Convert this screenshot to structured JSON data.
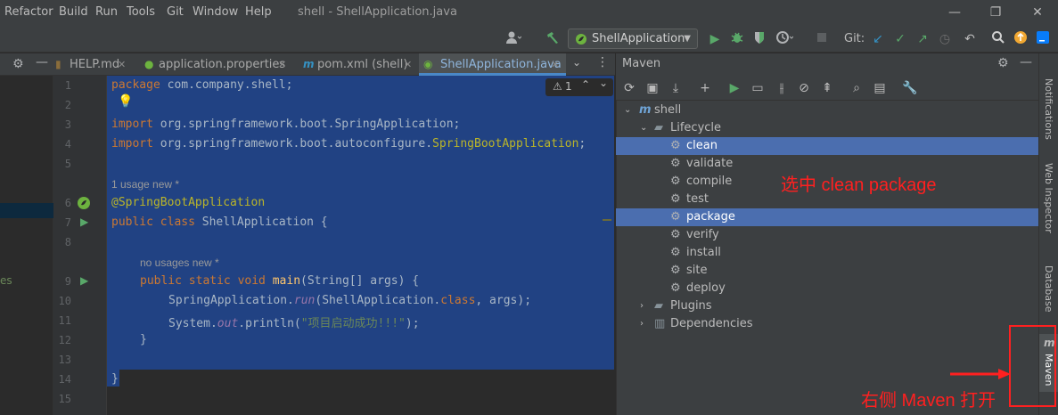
{
  "menubar": {
    "items": [
      "Refactor",
      "Build",
      "Run",
      "Tools",
      "Git",
      "Window",
      "Help"
    ],
    "window_title": "shell - ShellApplication.java",
    "controls": [
      "—",
      "❐",
      "✕"
    ]
  },
  "toolbar": {
    "run_config": "ShellApplication",
    "git_label": "Git:"
  },
  "tabs": [
    {
      "label": "HELP.md"
    },
    {
      "label": "application.properties"
    },
    {
      "label": "pom.xml (shell)"
    },
    {
      "label": "ShellApplication.java"
    }
  ],
  "editor": {
    "line_numbers": [
      "1",
      "2",
      "3",
      "4",
      "5",
      "6",
      "7",
      "8",
      "9",
      "10",
      "11",
      "12",
      "13",
      "14",
      "15"
    ],
    "inspection_count": "1",
    "lines": {
      "l1_kw": "package",
      "l1_rest": " com.company.shell;",
      "l3_kw": "import",
      "l3_rest": " org.springframework.boot.SpringApplication;",
      "l4_kw": "import",
      "l4_rest": " org.springframework.boot.autoconfigure.",
      "l4_ann": "SpringBootApplication",
      "l4_end": ";",
      "hint1": "1 usage   new *",
      "l6_ann": "@SpringBootApplication",
      "l7_kw": "public class",
      "l7_rest": " ShellApplication {",
      "hint2": "no usages   new *",
      "l9_kw": "public static void",
      "l9_fn": " main",
      "l9_rest": "(String[] args) {",
      "l10_a": "SpringApplication.",
      "l10_it": "run",
      "l10_b": "(ShellApplication.",
      "l10_kw": "class",
      "l10_c": ", args);",
      "l11_a": "System.",
      "l11_it": "out",
      "l11_b": ".println(",
      "l11_str": "\"项目启动成功!!!\"",
      "l11_c": ");",
      "l12": "}",
      "l14": "}"
    }
  },
  "maven": {
    "title": "Maven",
    "tree": {
      "project": "shell",
      "lifecycle": "Lifecycle",
      "goals": [
        "clean",
        "validate",
        "compile",
        "test",
        "package",
        "verify",
        "install",
        "site",
        "deploy"
      ],
      "plugins": "Plugins",
      "dependencies": "Dependencies"
    }
  },
  "right_sidebar": [
    "Notifications",
    "Web Inspector",
    "Database",
    "Maven"
  ],
  "left_strip_text": "es",
  "annotations": {
    "select_note": "选中 clean package",
    "open_note": "右侧 Maven 打开"
  },
  "colors": {
    "accent": "#4a88c7",
    "selection": "#214283",
    "tree_selection": "#4b6eaf",
    "annotation": "#ff2020"
  }
}
